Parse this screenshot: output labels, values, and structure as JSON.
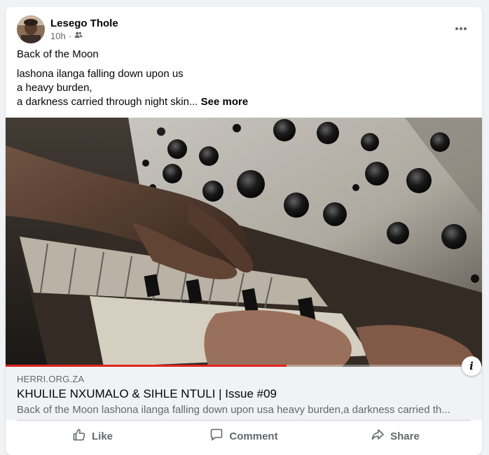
{
  "post": {
    "author": "Lesego Thole",
    "time": "10h",
    "separator": "·",
    "audience_icon": "friends-icon",
    "more_icon": "more-dots-icon",
    "title_line": "Back of the Moon",
    "body_lines": [
      "lashona ilanga falling down upon us",
      "a heavy burden,",
      "a darkness carried through night skin..."
    ],
    "see_more": "See more"
  },
  "media": {
    "video_progress_percent": 59,
    "progress_color": "#e1241f"
  },
  "link_preview": {
    "domain": "HERRI.ORG.ZA",
    "title": "KHULILE NXUMALO & SIHLE NTULI | Issue #09",
    "description": "Back of the Moon lashona ilanga falling down upon usa heavy burden,a darkness carried th...",
    "info_icon": "info-icon",
    "info_glyph": "i"
  },
  "actions": {
    "like": "Like",
    "comment": "Comment",
    "share": "Share"
  }
}
